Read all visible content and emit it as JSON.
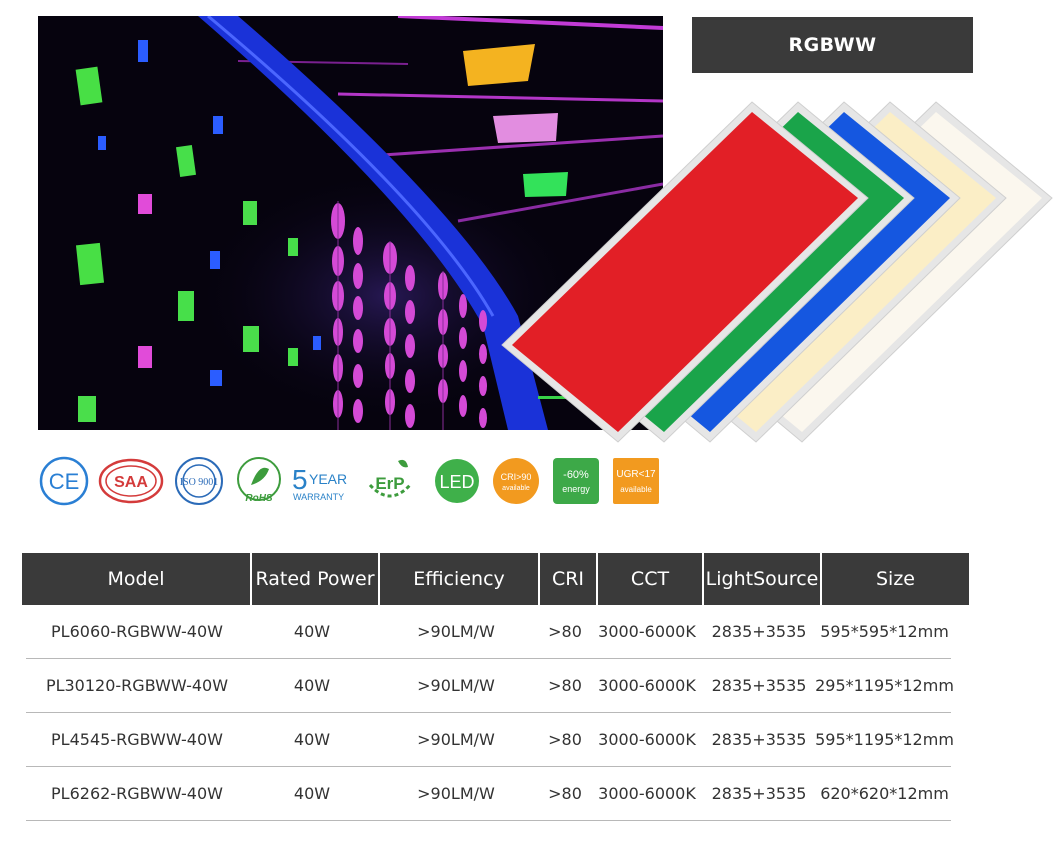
{
  "title_badge": "RGBWW",
  "certifications": [
    {
      "icon": "ce-mark-icon",
      "label": "CE"
    },
    {
      "icon": "saa-mark-icon",
      "label": "SAA"
    },
    {
      "icon": "iso-9001-icon",
      "label": "ISO 9001"
    },
    {
      "icon": "rohs-icon",
      "label": "RoHS"
    },
    {
      "icon": "warranty-icon",
      "label_big": "5",
      "label_small": "YEAR",
      "label_sub": "WARRANTY"
    },
    {
      "icon": "erp-icon",
      "label": "ErP"
    },
    {
      "icon": "led-icon",
      "label": "LED"
    },
    {
      "icon": "cri-icon",
      "label": "CRI>90",
      "label_sub": "available"
    },
    {
      "icon": "energy-icon",
      "label": "-60%",
      "label_sub": "energy"
    },
    {
      "icon": "ugr-icon",
      "label": "UGR<17",
      "label_sub": "available"
    }
  ],
  "panel_colors": [
    "#e21f26",
    "#1aa44a",
    "#1557e0",
    "#fbeec6",
    "#fbf7ee"
  ],
  "spec_table": {
    "headers": [
      "Model",
      "Rated Power",
      "Efficiency",
      "CRI",
      "CCT",
      "LightSource",
      "Size"
    ],
    "rows": [
      [
        "PL6060-RGBWW-40W",
        "40W",
        ">90LM/W",
        ">80",
        "3000-6000K",
        "2835+3535",
        "595*595*12mm"
      ],
      [
        "PL30120-RGBWW-40W",
        "40W",
        ">90LM/W",
        ">80",
        "3000-6000K",
        "2835+3535",
        "295*1195*12mm"
      ],
      [
        "PL4545-RGBWW-40W",
        "40W",
        ">90LM/W",
        ">80",
        "3000-6000K",
        "2835+3535",
        "595*1195*12mm"
      ],
      [
        "PL6262-RGBWW-40W",
        "40W",
        ">90LM/W",
        ">80",
        "3000-6000K",
        "2835+3535",
        "620*620*12mm"
      ]
    ]
  }
}
